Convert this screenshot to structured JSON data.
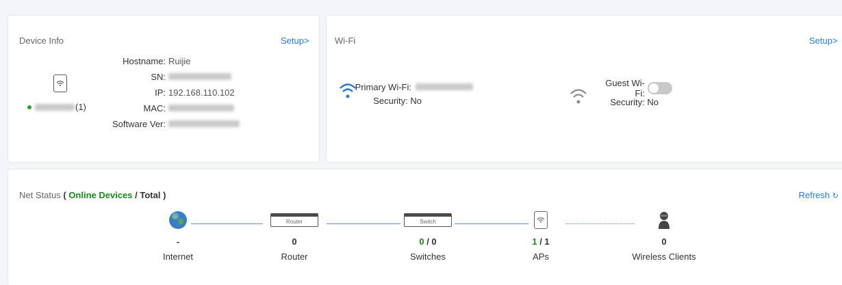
{
  "device_info": {
    "title": "Device Info",
    "setup_label": "Setup>",
    "device_suffix": "(1)",
    "hostname_label": "Hostname:",
    "hostname_value": "Ruijie",
    "sn_label": "SN:",
    "ip_label": "IP:",
    "ip_value": "192.168.110.102",
    "mac_label": "MAC:",
    "software_label": "Software Ver:"
  },
  "wifi": {
    "title": "Wi-Fi",
    "setup_label": "Setup>",
    "primary_label": "Primary Wi-Fi:",
    "primary_security": "Security: No",
    "guest_label": "Guest Wi-Fi:",
    "guest_enabled": false,
    "guest_security": "Security: No"
  },
  "net_status": {
    "title_prefix": "Net Status",
    "title_paren_open": "(",
    "title_online": "Online Devices",
    "title_total": "/ Total )",
    "refresh_label": "Refresh",
    "nodes": [
      {
        "name": "Internet",
        "count": "-",
        "box_label": "",
        "icon": "globe-icon"
      },
      {
        "name": "Router",
        "count": "0",
        "box_label": "Router",
        "icon": "router-icon"
      },
      {
        "name": "Switches",
        "online": "0",
        "total": "/ 0",
        "box_label": "Switch",
        "icon": "switch-icon"
      },
      {
        "name": "APs",
        "online": "1",
        "total": "/ 1",
        "box_label": "",
        "icon": "ap-icon"
      },
      {
        "name": "Wireless Clients",
        "count": "0",
        "box_label": "",
        "icon": "user-icon"
      }
    ]
  },
  "colors": {
    "accent": "#2b7bd6",
    "online": "#1a8a1a",
    "link": "#5b8fd6"
  }
}
